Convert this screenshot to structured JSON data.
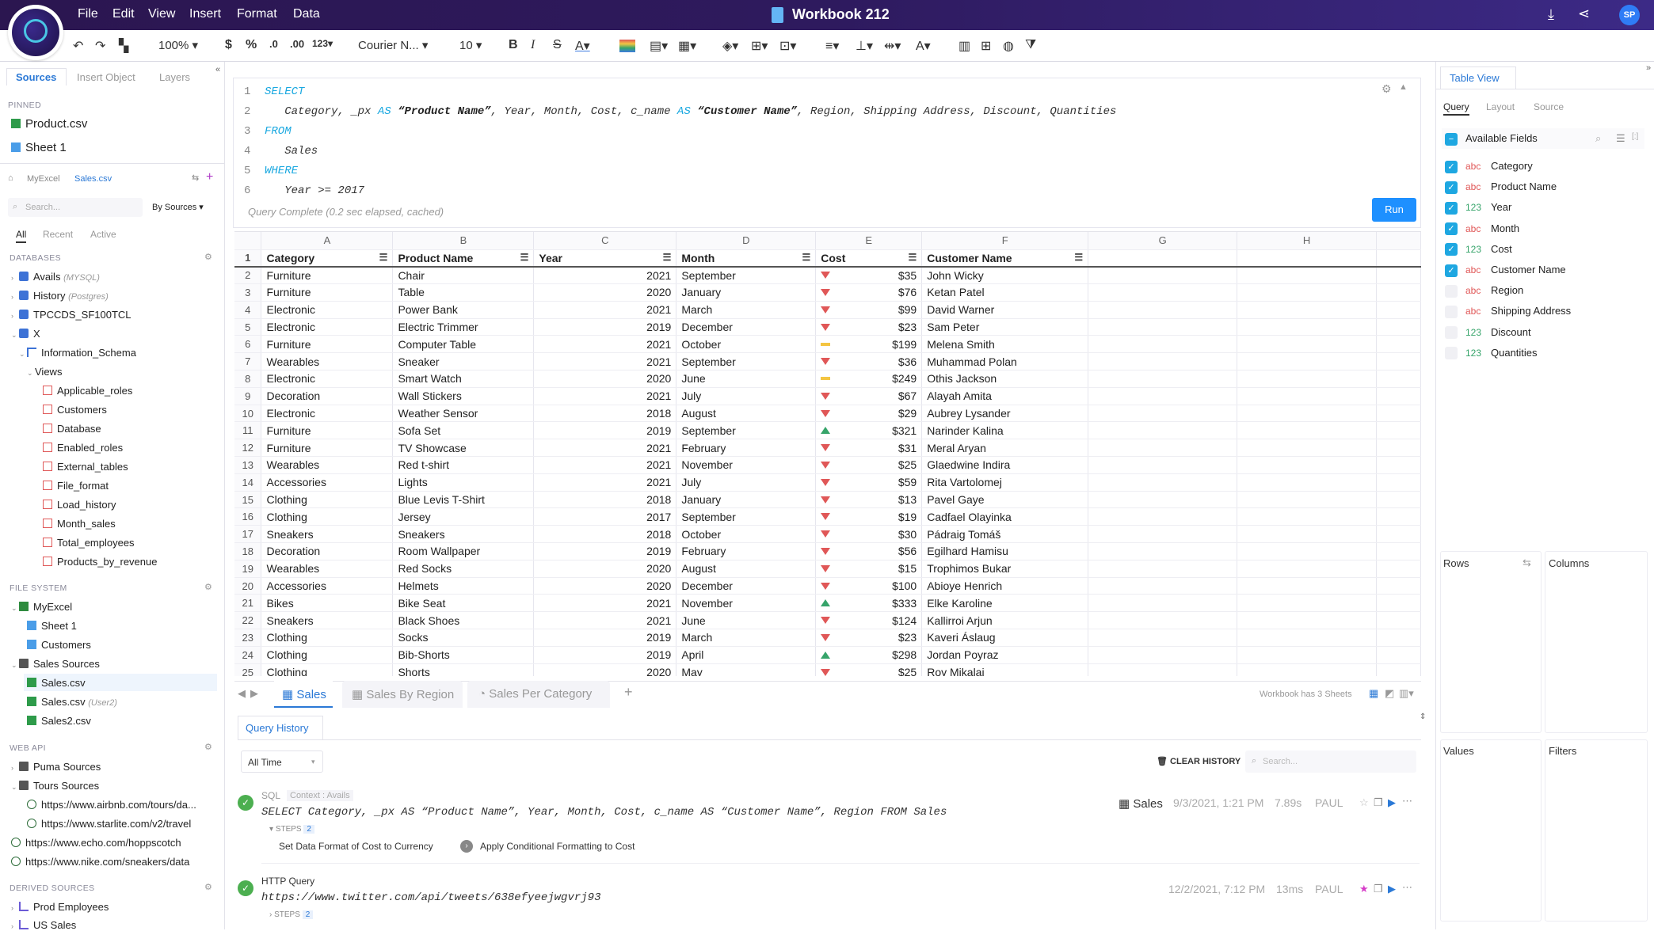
{
  "app": {
    "menu": [
      "File",
      "Edit",
      "View",
      "Insert",
      "Format",
      "Data"
    ],
    "workbook_title": "Workbook 212",
    "avatar": "SP"
  },
  "toolbar": {
    "zoom": "100%",
    "currency": "$",
    "percent": "%",
    "dec_dec": ".0",
    "dec_inc": ".00",
    "number_format": "123",
    "font": "Courier N...",
    "font_size": "10"
  },
  "left": {
    "tabs": [
      "Sources",
      "Insert Object",
      "Layers"
    ],
    "pinned_label": "PINNED",
    "pinned": [
      "Product.csv",
      "Sheet 1"
    ],
    "breadcrumb": [
      "MyExcel",
      "Sales.csv"
    ],
    "search_placeholder": "Search...",
    "by_sources": "By Sources",
    "filter_tabs": [
      "All",
      "Recent",
      "Active"
    ],
    "databases_label": "DATABASES",
    "databases": [
      {
        "name": "Avails",
        "sub": "(MYSQL)"
      },
      {
        "name": "History",
        "sub": "(Postgres)"
      },
      {
        "name": "TPCCDS_SF100TCL",
        "sub": ""
      },
      {
        "name": "X",
        "sub": ""
      }
    ],
    "schema": "Information_Schema",
    "views_label": "Views",
    "views": [
      "Applicable_roles",
      "Customers",
      "Database",
      "Enabled_roles",
      "External_tables",
      "File_format",
      "Load_history",
      "Month_sales",
      "Total_employees",
      "Products_by_revenue"
    ],
    "filesystem_label": "FILE SYSTEM",
    "myexcel": "MyExcel",
    "myexcel_children": [
      "Sheet 1",
      "Customers"
    ],
    "sales_sources": "Sales Sources",
    "sales_children": [
      {
        "name": "Sales.csv",
        "sub": ""
      },
      {
        "name": "Sales.csv",
        "sub": "(User2)"
      },
      {
        "name": "Sales2.csv",
        "sub": ""
      }
    ],
    "webapi_label": "WEB API",
    "puma": "Puma Sources",
    "tours": "Tours Sources",
    "tours_children": [
      "https://www.airbnb.com/tours/da...",
      "https://www.starlite.com/v2/travel"
    ],
    "web_links": [
      "https://www.echo.com/hoppscotch",
      "https://www.nike.com/sneakers/data"
    ],
    "derived_label": "DERIVED SOURCES",
    "derived": [
      "Prod Employees",
      "US Sales"
    ]
  },
  "query": {
    "lines": [
      {
        "n": "1",
        "parts": [
          {
            "t": "SELECT",
            "k": "kw"
          }
        ]
      },
      {
        "n": "2",
        "parts": [
          {
            "t": "   Category, _px ",
            "k": ""
          },
          {
            "t": "AS",
            "k": "kw"
          },
          {
            "t": " “Product Name”",
            "k": "str"
          },
          {
            "t": ", Year, Month, Cost, c_name ",
            "k": ""
          },
          {
            "t": "AS",
            "k": "kw"
          },
          {
            "t": " “Customer Name”",
            "k": "str"
          },
          {
            "t": ", Region, Shipping Address, Discount, Quantities",
            "k": ""
          }
        ]
      },
      {
        "n": "3",
        "parts": [
          {
            "t": "FROM",
            "k": "kw"
          }
        ]
      },
      {
        "n": "4",
        "parts": [
          {
            "t": "   Sales",
            "k": ""
          }
        ]
      },
      {
        "n": "5",
        "parts": [
          {
            "t": "WHERE",
            "k": "kw"
          }
        ]
      },
      {
        "n": "6",
        "parts": [
          {
            "t": "   Year >= 2017",
            "k": ""
          }
        ]
      }
    ],
    "status": "Query Complete (0.2 sec elapsed, cached)",
    "run": "Run"
  },
  "grid": {
    "columns": [
      "A",
      "B",
      "C",
      "D",
      "E",
      "F",
      "G",
      "H"
    ],
    "headers": [
      "Category",
      "Product Name",
      "Year",
      "Month",
      "Cost",
      "Customer Name"
    ],
    "rows": [
      [
        "Furniture",
        "Chair",
        "2021",
        "September",
        "down",
        "$35",
        "John Wicky"
      ],
      [
        "Furniture",
        "Table",
        "2020",
        "January",
        "down",
        "$76",
        "Ketan Patel"
      ],
      [
        "Electronic",
        "Power Bank",
        "2021",
        "March",
        "down",
        "$99",
        "David Warner"
      ],
      [
        "Electronic",
        "Electric Trimmer",
        "2019",
        "December",
        "down",
        "$23",
        "Sam Peter"
      ],
      [
        "Furniture",
        "Computer Table",
        "2021",
        "October",
        "flat",
        "$199",
        "Melena Smith"
      ],
      [
        "Wearables",
        "Sneaker",
        "2021",
        "September",
        "down",
        "$36",
        "Muhammad Polan"
      ],
      [
        "Electronic",
        "Smart Watch",
        "2020",
        "June",
        "flat",
        "$249",
        "Othis Jackson"
      ],
      [
        "Decoration",
        "Wall Stickers",
        "2021",
        "July",
        "down",
        "$67",
        "Alayah Amita"
      ],
      [
        "Electronic",
        "Weather Sensor",
        "2018",
        "August",
        "down",
        "$29",
        "Aubrey Lysander"
      ],
      [
        "Furniture",
        "Sofa Set",
        "2019",
        "September",
        "up",
        "$321",
        "Narinder Kalina"
      ],
      [
        "Furniture",
        "TV Showcase",
        "2021",
        "February",
        "down",
        "$31",
        "Meral Aryan"
      ],
      [
        "Wearables",
        "Red t-shirt",
        "2021",
        "November",
        "down",
        "$25",
        "Glaedwine Indira"
      ],
      [
        "Accessories",
        "Lights",
        "2021",
        "July",
        "down",
        "$59",
        "Rita Vartolomej"
      ],
      [
        "Clothing",
        "Blue Levis T-Shirt",
        "2018",
        "January",
        "down",
        "$13",
        "Pavel Gaye"
      ],
      [
        "Clothing",
        "Jersey",
        "2017",
        "September",
        "down",
        "$19",
        "Cadfael Olayinka"
      ],
      [
        "Sneakers",
        "Sneakers",
        "2018",
        "October",
        "down",
        "$30",
        "Pádraig Tomáš"
      ],
      [
        "Decoration",
        "Room Wallpaper",
        "2019",
        "February",
        "down",
        "$56",
        "Egilhard Hamisu"
      ],
      [
        "Wearables",
        "Red Socks",
        "2020",
        "August",
        "down",
        "$15",
        "Trophimos Bukar"
      ],
      [
        "Accessories",
        "Helmets",
        "2020",
        "December",
        "down",
        "$100",
        "Abioye Henrich"
      ],
      [
        "Bikes",
        "Bike Seat",
        "2021",
        "November",
        "up",
        "$333",
        "Elke Karoline"
      ],
      [
        "Sneakers",
        "Black Shoes",
        "2021",
        "June",
        "down",
        "$124",
        "Kallirroi Arjun"
      ],
      [
        "Clothing",
        "Socks",
        "2019",
        "March",
        "down",
        "$23",
        "Kaveri Áslaug"
      ],
      [
        "Clothing",
        "Bib-Shorts",
        "2019",
        "April",
        "up",
        "$298",
        "Jordan Poyraz"
      ],
      [
        "Clothing",
        "Shorts",
        "2020",
        "May",
        "down",
        "$25",
        "Roy Mikalai"
      ]
    ]
  },
  "sheets": {
    "tabs": [
      "Sales",
      "Sales By Region",
      "Sales Per Category"
    ],
    "count_text": "Workbook has 3 Sheets"
  },
  "history": {
    "tab": "Query History",
    "range": "All Time",
    "clear": "CLEAR HISTORY",
    "search_placeholder": "Search...",
    "entries": [
      {
        "type": "SQL",
        "context": "Context : Avails",
        "query": "SELECT Category, _px AS “Product Name”, Year, Month, Cost, c_name AS “Customer Name”, Region FROM Sales",
        "sheet": "Sales",
        "date": "9/3/2021, 1:21 PM",
        "duration": "7.89s",
        "user": "PAUL",
        "steps_label": "STEPS",
        "steps_count": "2",
        "steps": [
          "Set Data Format of Cost to Currency",
          "Apply Conditional Formatting to Cost"
        ]
      },
      {
        "type": "HTTP Query",
        "query": "https://www.twitter.com/api/tweets/638efyeejwgvrj93",
        "date": "12/2/2021, 7:12 PM",
        "duration": "13ms",
        "user": "PAUL",
        "steps_label": "STEPS",
        "steps_count": "2"
      }
    ]
  },
  "right": {
    "title": "Table View",
    "tabs": [
      "Query",
      "Layout",
      "Source"
    ],
    "available": "Available Fields",
    "fields": [
      {
        "type": "abc",
        "name": "Category",
        "checked": true
      },
      {
        "type": "abc",
        "name": "Product Name",
        "checked": true
      },
      {
        "type": "123",
        "name": "Year",
        "checked": true
      },
      {
        "type": "abc",
        "name": "Month",
        "checked": true
      },
      {
        "type": "123",
        "name": "Cost",
        "checked": true
      },
      {
        "type": "abc",
        "name": "Customer Name",
        "checked": true
      },
      {
        "type": "abc",
        "name": "Region",
        "checked": false
      },
      {
        "type": "abc",
        "name": "Shipping Address",
        "checked": false
      },
      {
        "type": "123",
        "name": "Discount",
        "checked": false
      },
      {
        "type": "123",
        "name": "Quantities",
        "checked": false
      }
    ],
    "rows": "Rows",
    "columns": "Columns",
    "values": "Values",
    "filters": "Filters"
  },
  "colors": {
    "accent": "#1e90ff",
    "topbar": "#2b1650",
    "up": "#36a46a",
    "down": "#e05757",
    "flat": "#f4c542"
  }
}
